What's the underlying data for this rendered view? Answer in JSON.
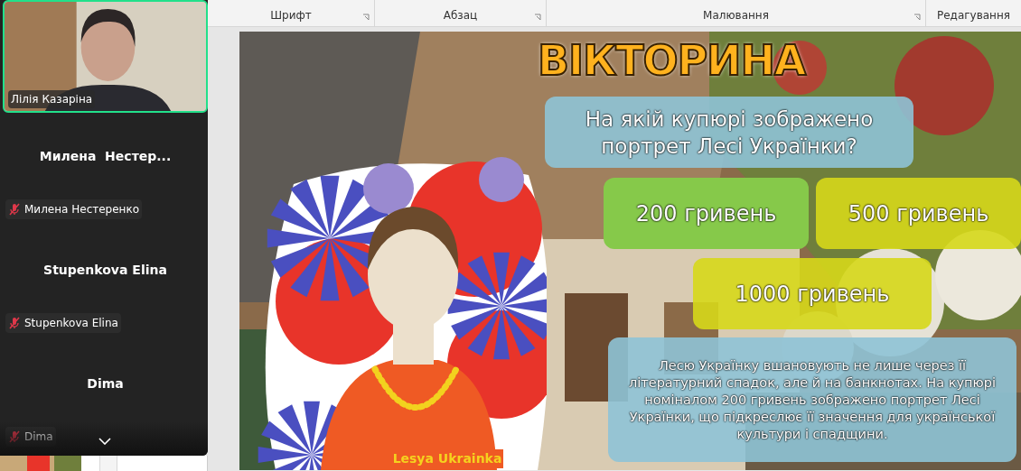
{
  "participants": [
    {
      "kind": "video",
      "label": "Лілія Казаріна",
      "muted": false
    },
    {
      "kind": "tile",
      "display_name": "Милена  Нестер...",
      "label": "Милена Нестеренко",
      "muted": true
    },
    {
      "kind": "tile",
      "display_name": "Stupenkova Elina",
      "label": "Stupenkova Elina",
      "muted": true
    },
    {
      "kind": "tile",
      "display_name": "Dima",
      "label": "Dima",
      "muted": true
    }
  ],
  "ribbon": {
    "groups": [
      {
        "label": "Шрифт",
        "launcher": true
      },
      {
        "label": "Абзац",
        "launcher": true
      },
      {
        "label": "Малювання",
        "launcher": true
      },
      {
        "label": "Редагування",
        "launcher": false
      }
    ]
  },
  "slide": {
    "title": "ВІКТОРИНА",
    "question": "На якій купюрі зображено портрет Лесі Українки?",
    "portrait_caption": "Lesya Ukrainka",
    "answers": [
      {
        "label": "200 гривень",
        "correct": true
      },
      {
        "label": "500 гривень",
        "correct": false
      },
      {
        "label": "1000 гривень",
        "correct": false
      }
    ],
    "explanation": "Лесю Українку вшановують не лише через її літературний спадок, але й на банкнотах. На купюрі номіналом 200 гривень зображено портрет Лесі Українки, що підкреслює її значення для української культури і спадщини."
  }
}
